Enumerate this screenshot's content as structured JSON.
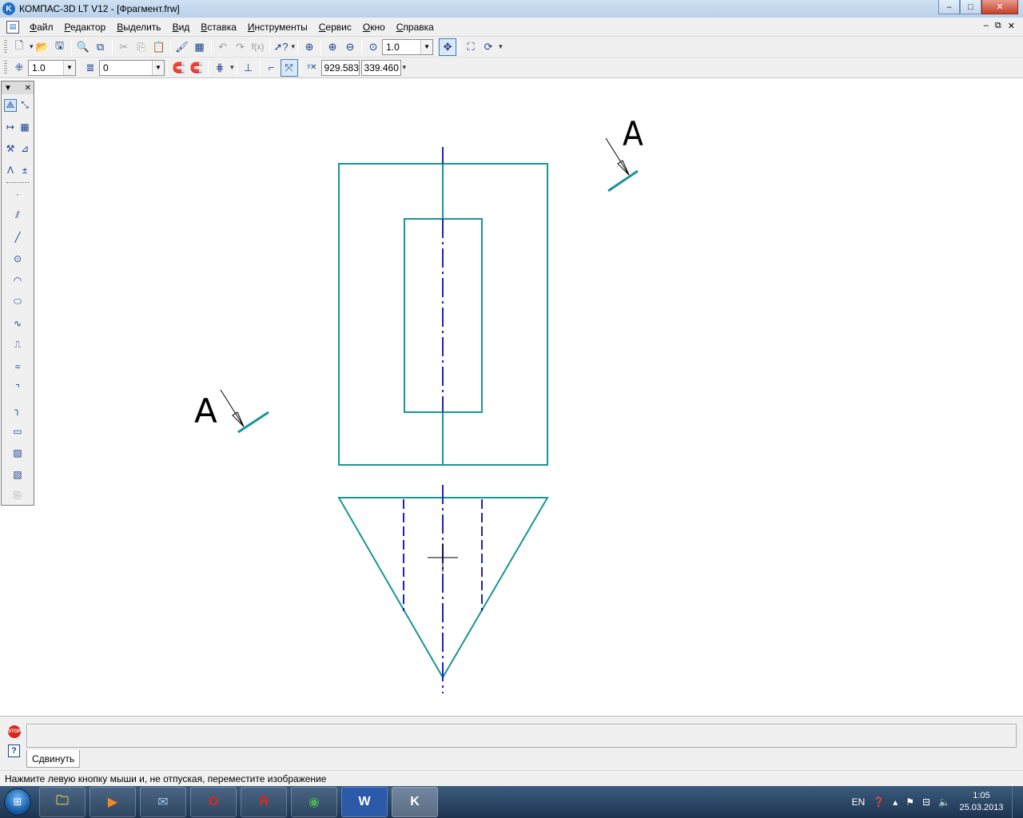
{
  "window": {
    "title": "КОМПАС-3D LT V12 - [Фрагмент.frw]",
    "minimize": "–",
    "maximize": "□",
    "close": "✕"
  },
  "menu": {
    "items": [
      "Файл",
      "Редактор",
      "Выделить",
      "Вид",
      "Вставка",
      "Инструменты",
      "Сервис",
      "Окно",
      "Справка"
    ],
    "mdi_minimize": "–",
    "mdi_restore": "⧉",
    "mdi_close": "✕"
  },
  "toolbar_main": {
    "zoom_value": "1.0"
  },
  "toolbar_current_state": {
    "step_value": "1.0",
    "layer_value": "0",
    "coord_x": "929.583",
    "coord_y": "339.460"
  },
  "drawing": {
    "section_label_left": "A",
    "section_label_right": "A",
    "colors": {
      "main_line": "#199595",
      "axis_line": "#1f1fc4",
      "hidden_line": "#1f1fc4"
    }
  },
  "command_panel": {
    "tab_label": "Сдвинуть",
    "stop_icon": "STOP",
    "help_icon": "?"
  },
  "status_bar": {
    "text": "Нажмите левую кнопку мыши и, не отпуская, переместите изображение"
  },
  "taskbar": {
    "apps": [
      "explorer-icon",
      "media-player-icon",
      "mail-icon",
      "opera-icon",
      "yandex-icon",
      "chrome-icon",
      "word-icon",
      "kompas-icon"
    ],
    "app_labels": [
      "",
      "",
      "",
      "O",
      "Я",
      "",
      "W",
      "K"
    ],
    "tray": {
      "language": "EN",
      "time": "1:05",
      "date": "25.03.2013"
    }
  }
}
